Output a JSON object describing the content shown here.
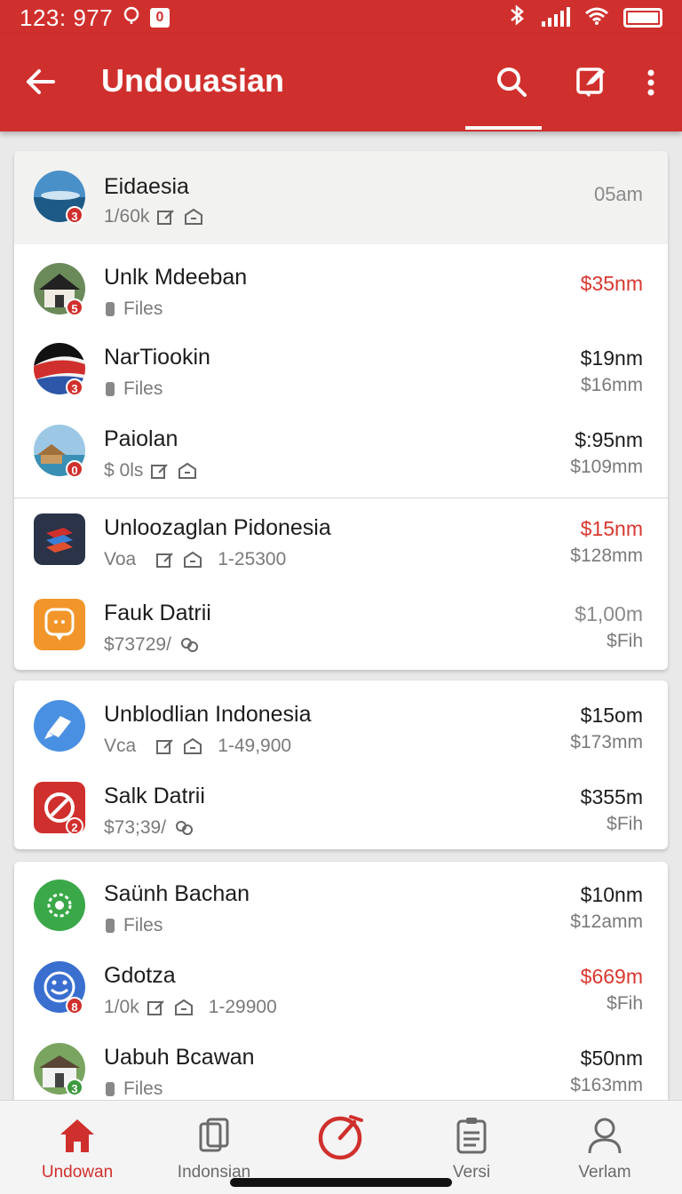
{
  "status_bar": {
    "time": "123: 977",
    "box_label": "0"
  },
  "app_bar": {
    "title": "Undouasian"
  },
  "colors": {
    "accent": "#d0302d",
    "price_red": "#d8382f"
  },
  "cards": [
    {
      "rows": [
        {
          "name": "Eidaesia",
          "sub": "1/60k",
          "time": "05am",
          "badge": "3"
        },
        {
          "name": "Unlk Mdeeban",
          "sub": "Files",
          "price1": "$35nm",
          "badge": "5"
        },
        {
          "name": "NarTiookin",
          "sub": "Files",
          "price1": "$19nm",
          "price2": "$16mm",
          "badge": "3"
        },
        {
          "name": "Paiolan",
          "sub": "$ 0ls",
          "price1": "$:95nm",
          "price2": "$109mm",
          "badge": "0"
        },
        {
          "name": "Unloozaglan Pidonesia",
          "sub": "Voa",
          "sub_num": "1-25300",
          "price1": "$15nm",
          "price2": "$128mm"
        },
        {
          "name": "Fauk Datrii",
          "sub": "$73729/",
          "price1": "$1,00m",
          "price2": "$Fih"
        }
      ]
    },
    {
      "rows": [
        {
          "name": "Unblodlian Indonesia",
          "sub": "Vca",
          "sub_num": "1-49,900",
          "price1": "$15om",
          "price2": "$173mm"
        },
        {
          "name": "Salk Datrii",
          "sub": "$73;39/",
          "price1": "$355m",
          "price2": "$Fih",
          "badge": "2"
        }
      ]
    },
    {
      "rows": [
        {
          "name": "Saünh Bachan",
          "sub": "Files",
          "price1": "$10nm",
          "price2": "$12amm"
        },
        {
          "name": "Gdotza",
          "sub": "1/0k",
          "sub_num": "1-29900",
          "price1": "$669m",
          "price2": "$Fih",
          "badge": "8"
        },
        {
          "name": "Uabuh Bcawan",
          "sub": "Files",
          "price1": "$50nm",
          "price2": "$163mm",
          "badge": "3"
        }
      ]
    }
  ],
  "bottom_nav": [
    {
      "label": "Undowan",
      "icon": "home-icon"
    },
    {
      "label": "Indonsian",
      "icon": "book-icon"
    },
    {
      "label": "",
      "icon": "gauge-icon"
    },
    {
      "label": "Versi",
      "icon": "clipboard-icon"
    },
    {
      "label": "Verlam",
      "icon": "person-icon"
    }
  ]
}
